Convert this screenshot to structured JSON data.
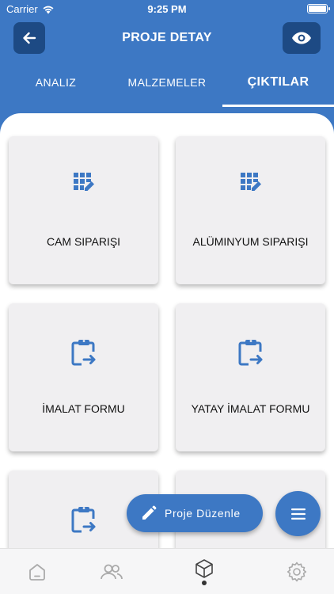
{
  "status_bar": {
    "carrier": "Carrier",
    "time": "9:25 PM"
  },
  "header": {
    "title": "PROJE DETAY"
  },
  "tabs": [
    {
      "label": "ANALIZ",
      "active": false
    },
    {
      "label": "MALZEMELER",
      "active": false
    },
    {
      "label": "ÇIKTILAR",
      "active": true
    }
  ],
  "cards": [
    {
      "label": "CAM SIPARIŞI",
      "icon": "grid-edit-icon"
    },
    {
      "label": "ALÜMINYUM SIPARIŞI",
      "icon": "grid-edit-icon"
    },
    {
      "label": "İMALAT FORMU",
      "icon": "clipboard-arrow-icon"
    },
    {
      "label": "YATAY İMALAT FORMU",
      "icon": "clipboard-arrow-icon"
    },
    {
      "label": "",
      "icon": "clipboard-arrow-icon"
    },
    {
      "label": "",
      "icon": ""
    }
  ],
  "fab": {
    "edit_label": "Proje Düzenle"
  },
  "colors": {
    "primary": "#3d78c4",
    "header_button": "#1d4a84",
    "card_bg": "#f0eff1"
  }
}
